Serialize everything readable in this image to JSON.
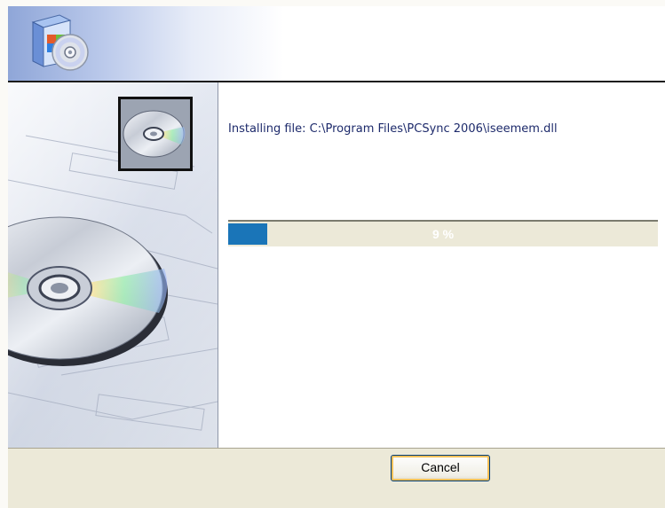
{
  "installer": {
    "status_text": "Installing file: C:\\Program Files\\PCSync 2006\\iseemem.dll",
    "progress": {
      "percent": 9,
      "label": "9 %"
    },
    "cancel_label": "Cancel"
  },
  "icons": {
    "header": "installer-box-cd-icon",
    "side_top": "cd-disc-icon",
    "side_large": "cd-disc-artwork"
  },
  "colors": {
    "progress_fill": "#1a75b8",
    "progress_track": "#ece9d8",
    "text": "#1d2a6b",
    "footer": "#ece9d8"
  }
}
